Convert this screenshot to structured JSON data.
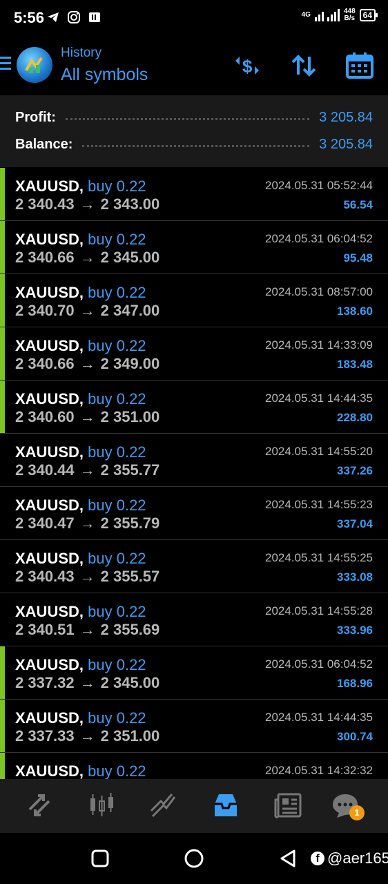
{
  "status_bar": {
    "time": "5:56",
    "icons": [
      "telegram-icon",
      "instagram-icon",
      "app-icon"
    ],
    "network": "4G",
    "speed_top": "448",
    "speed_bottom": "B/s",
    "battery": "64"
  },
  "header": {
    "subtitle": "History",
    "title": "All symbols",
    "actions": [
      "currency-exchange-icon",
      "sort-icon",
      "calendar-icon"
    ]
  },
  "summary": {
    "profit_label": "Profit:",
    "profit_value": "3 205.84",
    "balance_label": "Balance:",
    "balance_value": "3 205.84"
  },
  "deals": [
    {
      "symbol": "XAUUSD,",
      "side": "buy 0.22",
      "open": "2 340.43",
      "arrow": "→",
      "close": "2 343.00",
      "time": "2024.05.31 05:52:44",
      "profit": "56.54",
      "marked": true
    },
    {
      "symbol": "XAUUSD,",
      "side": "buy 0.22",
      "open": "2 340.66",
      "arrow": "→",
      "close": "2 345.00",
      "time": "2024.05.31 06:04:52",
      "profit": "95.48",
      "marked": true
    },
    {
      "symbol": "XAUUSD,",
      "side": "buy 0.22",
      "open": "2 340.70",
      "arrow": "→",
      "close": "2 347.00",
      "time": "2024.05.31 08:57:00",
      "profit": "138.60",
      "marked": true
    },
    {
      "symbol": "XAUUSD,",
      "side": "buy 0.22",
      "open": "2 340.66",
      "arrow": "→",
      "close": "2 349.00",
      "time": "2024.05.31 14:33:09",
      "profit": "183.48",
      "marked": true
    },
    {
      "symbol": "XAUUSD,",
      "side": "buy 0.22",
      "open": "2 340.60",
      "arrow": "→",
      "close": "2 351.00",
      "time": "2024.05.31 14:44:35",
      "profit": "228.80",
      "marked": true
    },
    {
      "symbol": "XAUUSD,",
      "side": "buy 0.22",
      "open": "2 340.44",
      "arrow": "→",
      "close": "2 355.77",
      "time": "2024.05.31 14:55:20",
      "profit": "337.26",
      "marked": false
    },
    {
      "symbol": "XAUUSD,",
      "side": "buy 0.22",
      "open": "2 340.47",
      "arrow": "→",
      "close": "2 355.79",
      "time": "2024.05.31 14:55:23",
      "profit": "337.04",
      "marked": false
    },
    {
      "symbol": "XAUUSD,",
      "side": "buy 0.22",
      "open": "2 340.43",
      "arrow": "→",
      "close": "2 355.57",
      "time": "2024.05.31 14:55:25",
      "profit": "333.08",
      "marked": false
    },
    {
      "symbol": "XAUUSD,",
      "side": "buy 0.22",
      "open": "2 340.51",
      "arrow": "→",
      "close": "2 355.69",
      "time": "2024.05.31 14:55:28",
      "profit": "333.96",
      "marked": false
    },
    {
      "symbol": "XAUUSD,",
      "side": "buy 0.22",
      "open": "2 337.32",
      "arrow": "→",
      "close": "2 345.00",
      "time": "2024.05.31 06:04:52",
      "profit": "168.96",
      "marked": true
    },
    {
      "symbol": "XAUUSD,",
      "side": "buy 0.22",
      "open": "2 337.33",
      "arrow": "→",
      "close": "2 351.00",
      "time": "2024.05.31 14:44:35",
      "profit": "300.74",
      "marked": true
    },
    {
      "symbol": "XAUUSD,",
      "side": "buy 0.22",
      "open": "",
      "arrow": "",
      "close": "",
      "time": "2024.05.31 14:32:32",
      "profit": "",
      "marked": true
    }
  ],
  "bottom_nav": {
    "items": [
      "quotes-icon",
      "chart-icon",
      "trade-icon",
      "history-icon",
      "news-icon",
      "messages-icon"
    ],
    "active": "history-icon",
    "badge": "1"
  },
  "system_nav": {
    "watermark": "@aer165"
  },
  "colors": {
    "accent": "#3b9cf4",
    "buy_marker": "#7bc423",
    "summary_bg": "#1a1a1a",
    "nav_bg": "#1c1c1c"
  }
}
